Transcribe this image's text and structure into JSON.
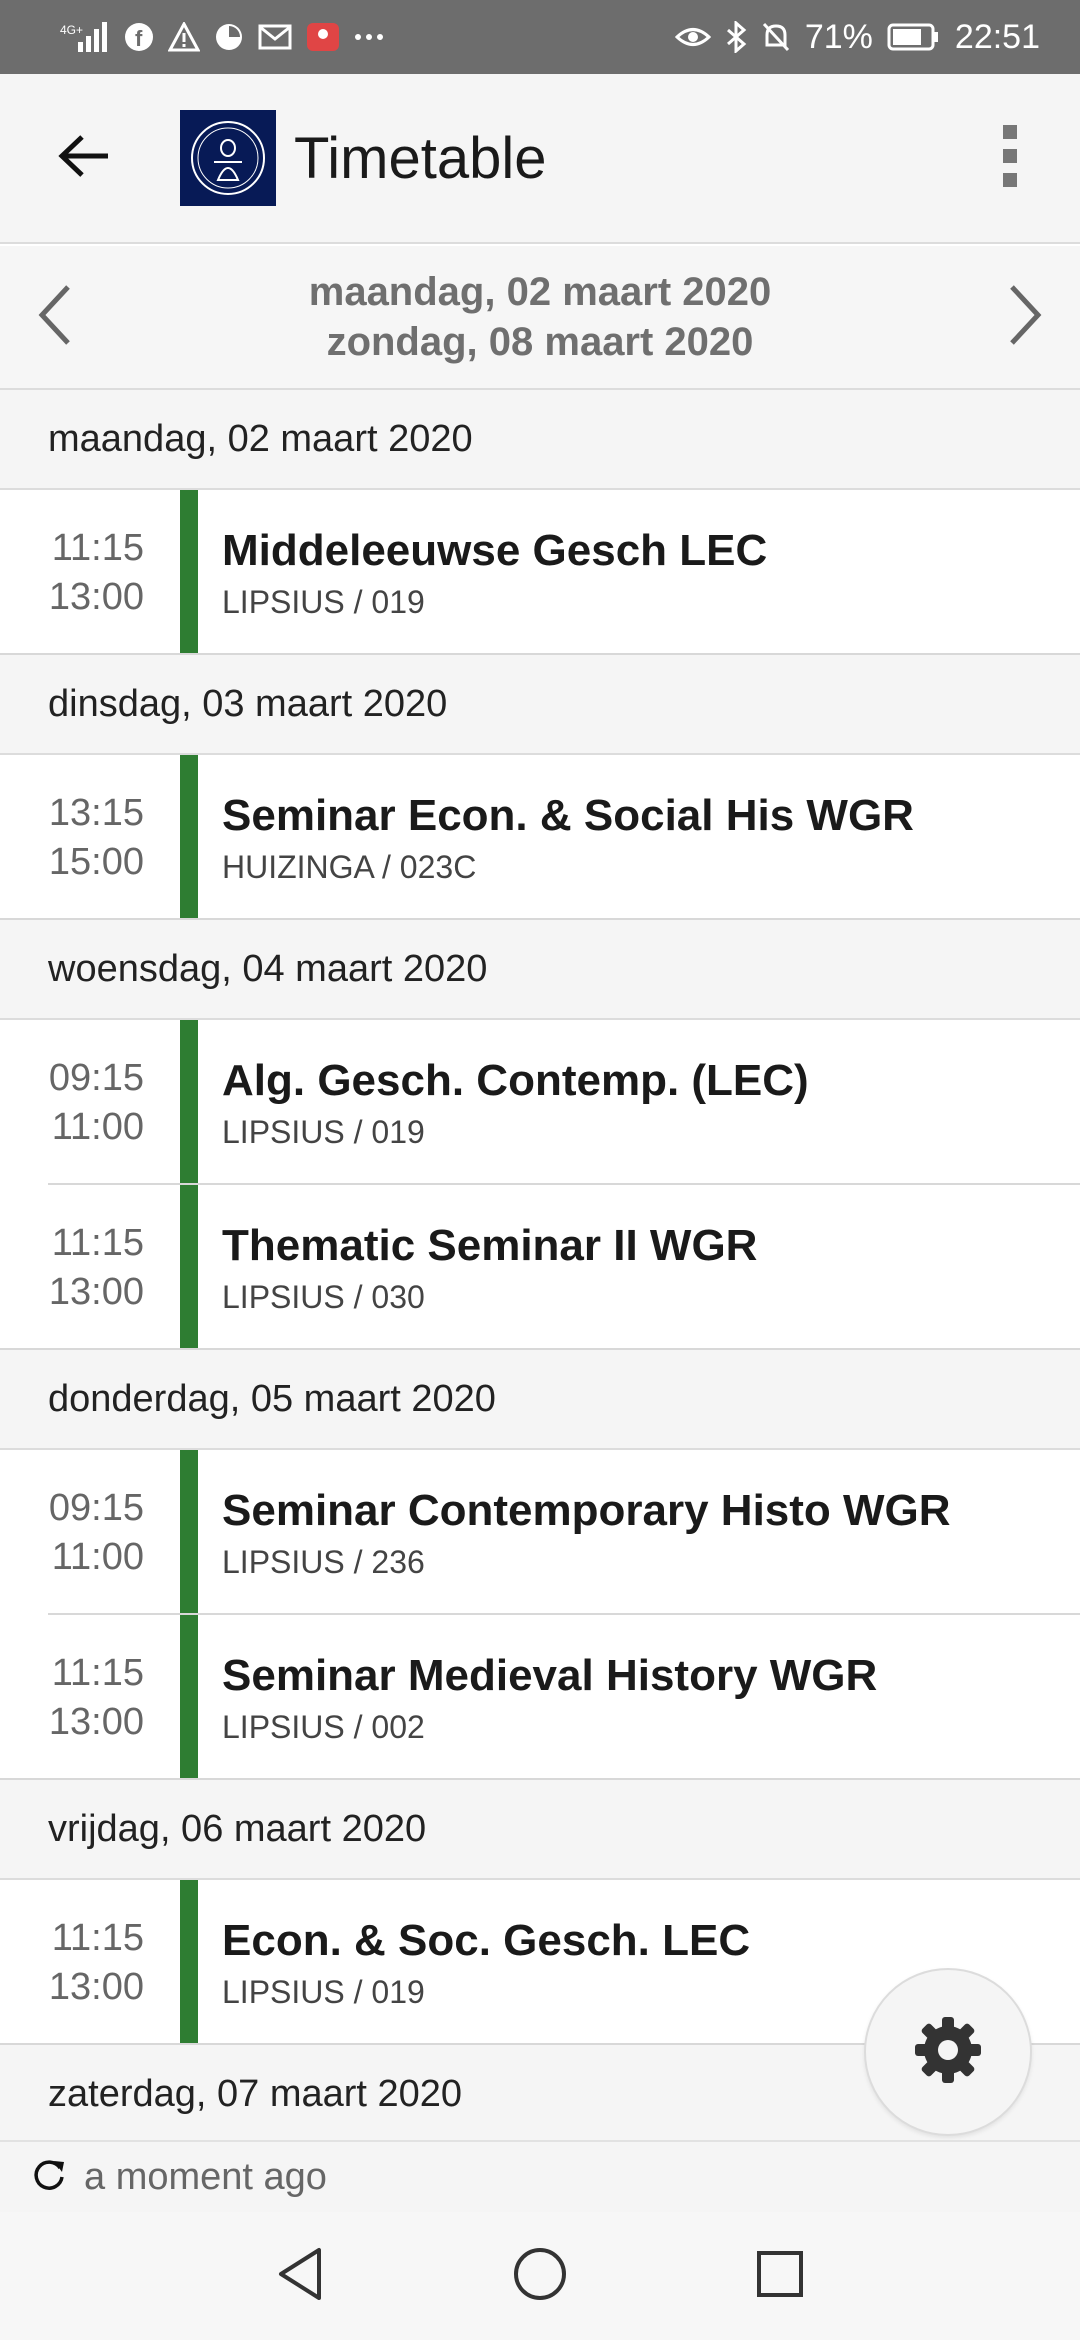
{
  "status_bar": {
    "network": "4G+",
    "battery": "71%",
    "time": "22:51",
    "icons_left": [
      "signal-icon",
      "facebook-icon",
      "warning-icon",
      "data-saver-icon",
      "gmail-icon",
      "huawei-icon",
      "more-dots-icon"
    ],
    "icons_right": [
      "eye-comfort-icon",
      "bluetooth-icon",
      "mute-icon",
      "battery-icon"
    ]
  },
  "app_bar": {
    "title": "Timetable",
    "back_icon": "arrow-back-icon",
    "logo": "university-seal-logo",
    "menu_icon": "overflow-menu-icon"
  },
  "week_nav": {
    "start": "maandag, 02 maart 2020",
    "end": "zondag, 08 maart 2020",
    "prev_icon": "chevron-left-icon",
    "next_icon": "chevron-right-icon"
  },
  "days": [
    {
      "label": "maandag, 02 maart 2020",
      "events": [
        {
          "start": "11:15",
          "end": "13:00",
          "title": "Middeleeuwse Gesch LEC",
          "location": "LIPSIUS / 019"
        }
      ]
    },
    {
      "label": "dinsdag, 03 maart 2020",
      "events": [
        {
          "start": "13:15",
          "end": "15:00",
          "title": "Seminar Econ. & Social His WGR",
          "location": "HUIZINGA / 023C"
        }
      ]
    },
    {
      "label": "woensdag, 04 maart 2020",
      "events": [
        {
          "start": "09:15",
          "end": "11:00",
          "title": "Alg. Gesch. Contemp. (LEC)",
          "location": "LIPSIUS / 019"
        },
        {
          "start": "11:15",
          "end": "13:00",
          "title": "Thematic Seminar II WGR",
          "location": "LIPSIUS / 030"
        }
      ]
    },
    {
      "label": "donderdag, 05 maart 2020",
      "events": [
        {
          "start": "09:15",
          "end": "11:00",
          "title": "Seminar Contemporary Histo WGR",
          "location": "LIPSIUS / 236"
        },
        {
          "start": "11:15",
          "end": "13:00",
          "title": "Seminar Medieval History WGR",
          "location": "LIPSIUS / 002"
        }
      ]
    },
    {
      "label": "vrijdag, 06 maart 2020",
      "events": [
        {
          "start": "11:15",
          "end": "13:00",
          "title": "Econ. & Soc. Gesch. LEC",
          "location": "LIPSIUS / 019"
        }
      ]
    },
    {
      "label": "zaterdag, 07 maart 2020",
      "events": []
    }
  ],
  "footer": {
    "last_updated": "a moment ago",
    "refresh_icon": "refresh-icon"
  },
  "fab": {
    "icon": "settings-gear-icon"
  },
  "colors": {
    "accent": "#2e7d32",
    "logo_bg": "#071a56",
    "status_bar": "#6d6d6d"
  }
}
